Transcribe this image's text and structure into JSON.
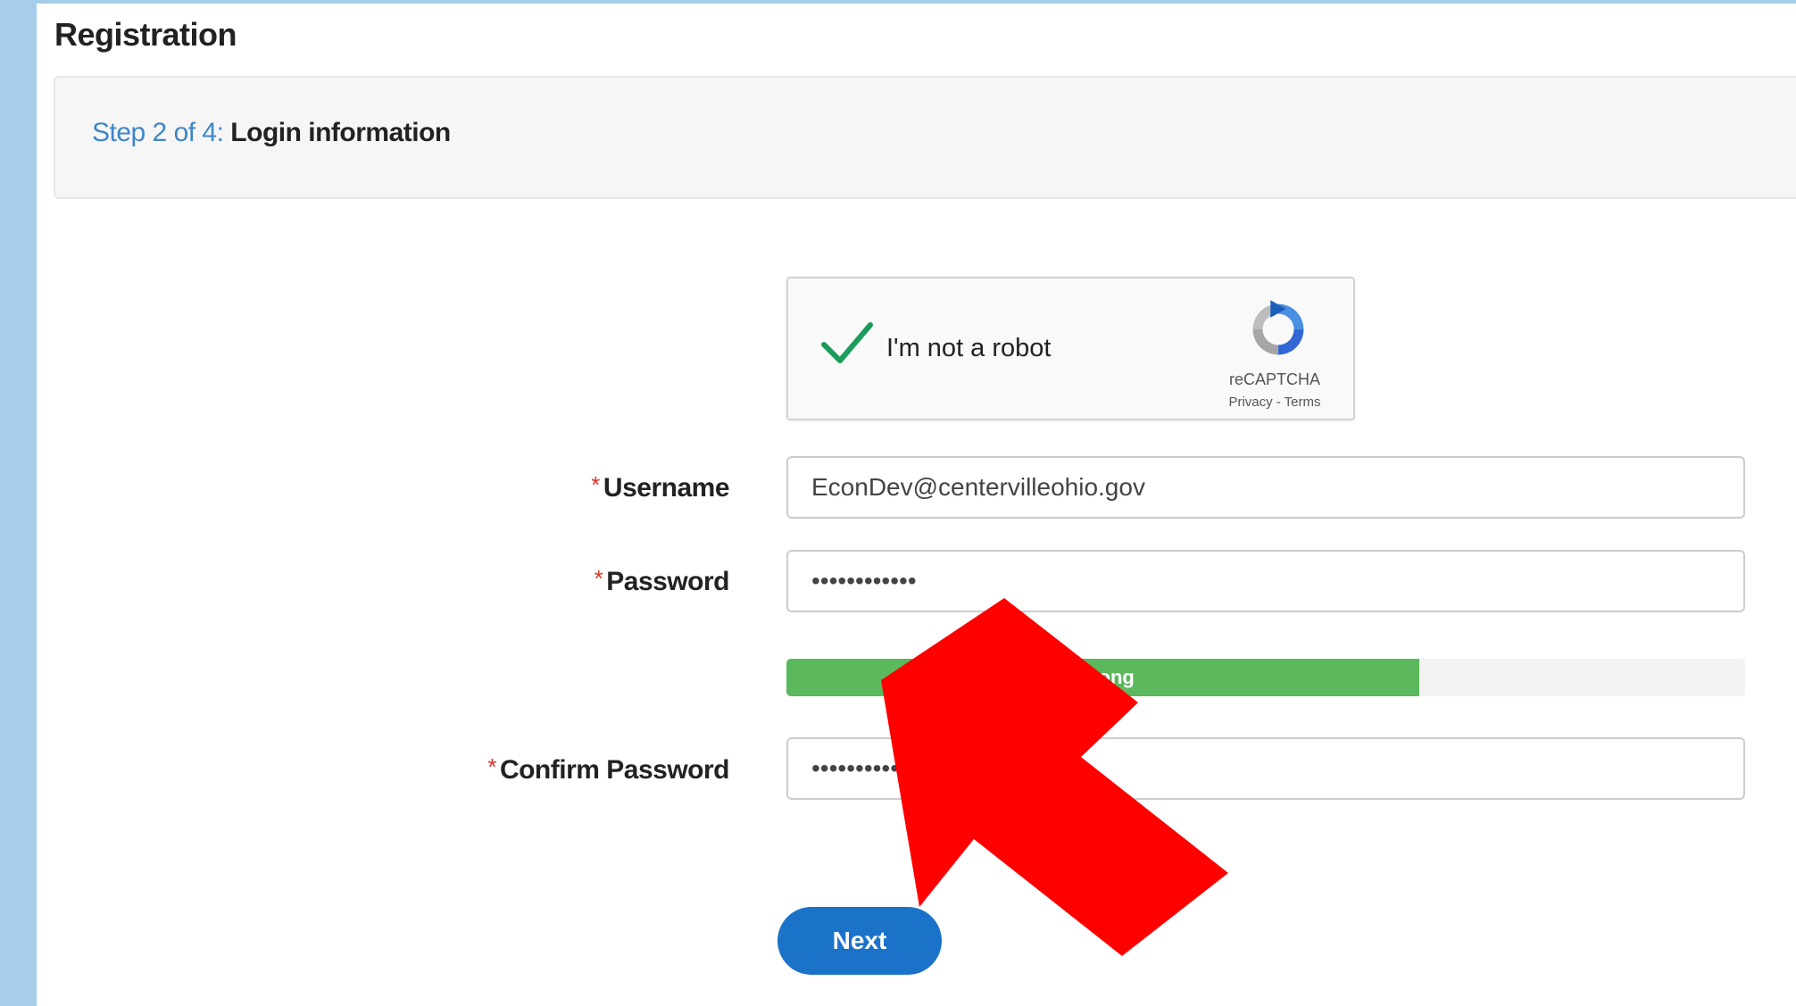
{
  "page": {
    "title": "Registration"
  },
  "step": {
    "prefix": "Step 2 of 4:",
    "name": "Login information"
  },
  "recaptcha": {
    "label": "I'm not a robot",
    "brand": "reCAPTCHA",
    "links": "Privacy - Terms",
    "checked": true,
    "check_color": "#1a9c5a"
  },
  "form": {
    "required_marker": "*",
    "username": {
      "label": "Username",
      "value": "EconDev@centervilleohio.gov"
    },
    "password": {
      "label": "Password",
      "value": "••••••••••••"
    },
    "strength": {
      "label": "Strong",
      "percent": 66,
      "color": "#5cb85c"
    },
    "confirm_password": {
      "label": "Confirm Password",
      "value": "••••••••••••"
    }
  },
  "actions": {
    "next_label": "Next"
  },
  "annotation": {
    "arrow_color": "#ff0000"
  }
}
